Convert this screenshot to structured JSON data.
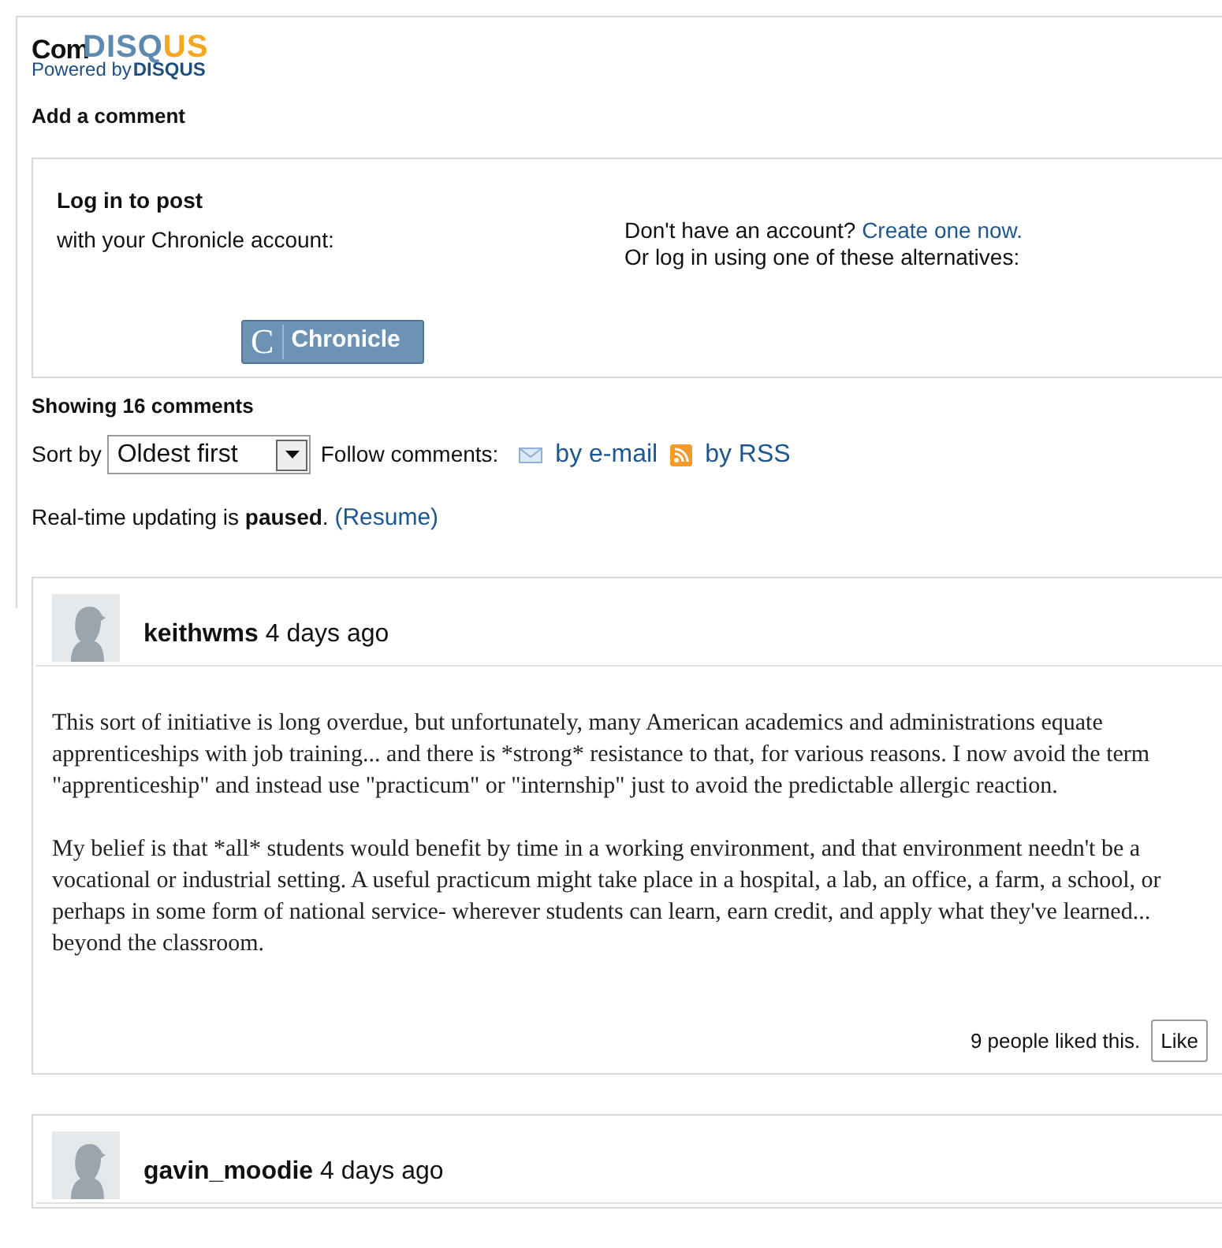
{
  "header": {
    "title": "Com",
    "logo": "DISQUS",
    "powered_by": "Powered by",
    "powered_logo": "DISQUS"
  },
  "add_comment": "Add a comment",
  "login": {
    "title": "Log in to post",
    "subtitle": "with your Chronicle account:",
    "no_account": "Don't have an account?",
    "create_link": "Create one now.",
    "alternatives": "Or log in using one of these alternatives:",
    "button_icon": "C",
    "button_label": "Chronicle"
  },
  "showing": "Showing 16 comments",
  "sort": {
    "label": "Sort by",
    "value": "Oldest first"
  },
  "follow": {
    "label": "Follow comments:",
    "email": "by e-mail",
    "rss": "by RSS"
  },
  "realtime": {
    "text": "Real-time updating is **paused**.",
    "link": "(Resume)"
  },
  "comments": [
    {
      "author": "keithwms",
      "time": "4 days ago",
      "paragraphs": [
        "This sort of initiative is long overdue, but unfortunately, many American academics and administrations equate apprenticeships with job training... and there is *strong* resistance to that, for various reasons. I now avoid the term \"apprenticeship\" and instead use \"practicum\" or \"internship\" just to avoid the predictable allergic reaction.",
        "My belief is that *all* students would benefit by time in a working environment, and that environment needn't be a vocational or industrial setting. A useful practicum might take place in a hospital, a lab, an office, a farm, a school, or perhaps in some form of national service- wherever students can learn, earn credit, and apply what they've learned... beyond the classroom."
      ],
      "likes": "9 people liked this.",
      "like_button": "Like"
    },
    {
      "author": "gavin_moodie",
      "time": "4 days ago"
    }
  ]
}
